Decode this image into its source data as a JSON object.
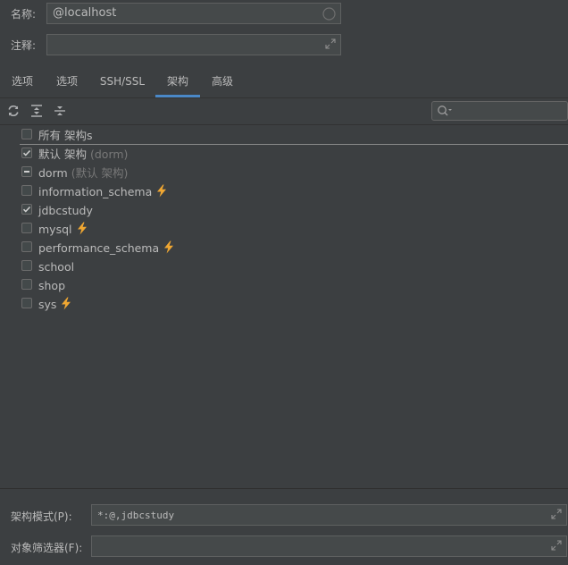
{
  "form": {
    "name_label": "名称:",
    "name_value": "@localhost",
    "comment_label": "注释:",
    "comment_value": ""
  },
  "tabs": [
    {
      "label": "选项",
      "active": false
    },
    {
      "label": "选项",
      "active": false
    },
    {
      "label": "SSH/SSL",
      "active": false
    },
    {
      "label": "架构",
      "active": true
    },
    {
      "label": "高级",
      "active": false
    }
  ],
  "toolbar": {
    "icons": [
      "refresh-icon",
      "expand-all-icon",
      "collapse-all-icon"
    ],
    "search_placeholder": ""
  },
  "schemas": [
    {
      "label": "所有 架构s",
      "hint": "",
      "checked": false,
      "partial": false,
      "bolt": false
    },
    {
      "label": "默认 架构",
      "hint": "(dorm)",
      "checked": true,
      "partial": false,
      "bolt": false
    },
    {
      "label": "dorm",
      "hint": "(默认 架构)",
      "checked": false,
      "partial": true,
      "bolt": false
    },
    {
      "label": "information_schema",
      "hint": "",
      "checked": false,
      "partial": false,
      "bolt": true
    },
    {
      "label": "jdbcstudy",
      "hint": "",
      "checked": true,
      "partial": false,
      "bolt": false
    },
    {
      "label": "mysql",
      "hint": "",
      "checked": false,
      "partial": false,
      "bolt": true
    },
    {
      "label": "performance_schema",
      "hint": "",
      "checked": false,
      "partial": false,
      "bolt": true
    },
    {
      "label": "school",
      "hint": "",
      "checked": false,
      "partial": false,
      "bolt": false
    },
    {
      "label": "shop",
      "hint": "",
      "checked": false,
      "partial": false,
      "bolt": false
    },
    {
      "label": "sys",
      "hint": "",
      "checked": false,
      "partial": false,
      "bolt": true
    }
  ],
  "bottom": {
    "pattern_label": "架构模式(P):",
    "pattern_value": "*:@,jdbcstudy",
    "filter_label": "对象筛选器(F):",
    "filter_value": ""
  },
  "colors": {
    "background": "#3c3f41",
    "accent": "#4a88c7",
    "bolt": "#f0a732"
  }
}
